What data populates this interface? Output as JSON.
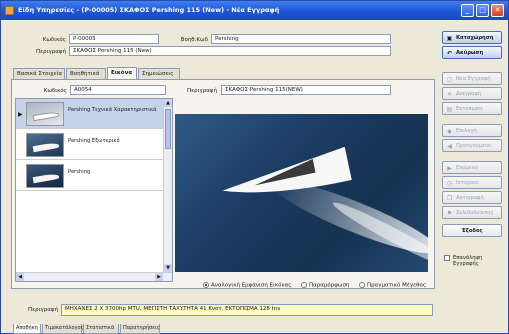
{
  "window": {
    "title": "Είδη Υπηρεσίες - (P-00005) ΣΚΑΦΟΣ Pershing 115 (New) - Νέα Εγγραφή"
  },
  "header": {
    "code_label": "Κωδικός",
    "code_value": "P-00005",
    "aux_code_label": "Βοηθ.Κωδ",
    "aux_code_value": "Pershing",
    "description_label": "Περιγραφή",
    "description_value": "ΣΚΑΦΟΣ Pershing 115 (New)"
  },
  "tabs": [
    {
      "label": "Βασικά Στοιχεία"
    },
    {
      "label": "Βοηθητικά"
    },
    {
      "label": "Εικόνα"
    },
    {
      "label": "Σημειώσεις"
    }
  ],
  "image_tab": {
    "code_label": "Κωδικός",
    "code_value": "A0054",
    "description_label": "Περιγραφή",
    "description_value": "ΣΚΑΦΟΣ Pershing 115(NEW)",
    "list_items": [
      {
        "label": "Pershing Τεχνικά Χαρακτηριστικά"
      },
      {
        "label": "Pershing Εξωτερικό"
      },
      {
        "label": "Pershing"
      }
    ],
    "display_options": [
      {
        "label": "Αναλογική Εμφάνιση Εικόνας"
      },
      {
        "label": "Παραμόρφωση"
      },
      {
        "label": "Πραγματικό Μέγεθος"
      }
    ],
    "caption_label": "Περιγραφή",
    "caption_value": "ΜΗΧΑΝΕΣ 2 Χ 3700hp MTU, ΜΕΓΙΣΤΗ ΤΑΧΥΤΗΤΑ 41 Κνότ, ΕΚΤΟΠΙΣΜΑ 128 tns"
  },
  "side_buttons": {
    "save": "Καταχώρηση",
    "cancel": "Ακύρωση",
    "new_record": "Νέα Εγγραφή",
    "delete": "Διαγραφή",
    "other": "Εκτύπωση",
    "search": "Επιλογή",
    "preview": "Προηγούμενο",
    "next": "Επόμενο",
    "history": "Ιστορικό",
    "copy": "Αντιγραφή",
    "bookmark": "Σελιδοδείκτης",
    "exit": "Έξοδος",
    "keep_open_label": "Επανάληψη Εγγραφής"
  },
  "bottom_tabs": [
    {
      "label": "Αποθήκη"
    },
    {
      "label": "Τιμοκατάλογος"
    },
    {
      "label": "Στατιστικά"
    },
    {
      "label": "Παρατηρήσεις"
    }
  ],
  "colors": {
    "titlebar": "#1d56d6",
    "window_bg": "#ece9d8",
    "selection": "#c6d3ea",
    "caption_bg": "#fff9c4"
  }
}
